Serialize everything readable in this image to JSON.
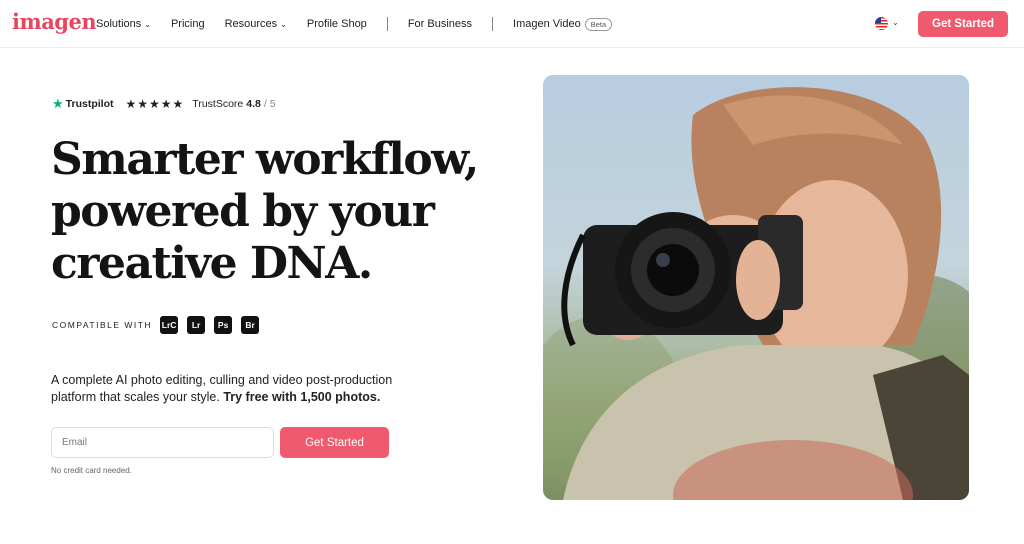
{
  "brand": {
    "logo_text": "imagen",
    "accent": "#f05a6e"
  },
  "nav": {
    "items": [
      {
        "label": "Solutions",
        "has_dropdown": true
      },
      {
        "label": "Pricing",
        "has_dropdown": false
      },
      {
        "label": "Resources",
        "has_dropdown": true
      },
      {
        "label": "Profile Shop",
        "has_dropdown": false
      }
    ],
    "business": "For Business",
    "video": "Imagen Video",
    "video_badge": "Beta",
    "language_icon": "us-flag-icon",
    "cta": "Get Started"
  },
  "hero": {
    "trustpilot": {
      "brand": "Trustpilot",
      "stars": "★★★★★",
      "label": "TrustScore",
      "score": "4.8",
      "out_of": "/ 5"
    },
    "headline": [
      "Smarter workflow,",
      "powered by your",
      "creative DNA."
    ],
    "compatible_label": "COMPATIBLE WITH",
    "apps": [
      "LrC",
      "Lr",
      "Ps",
      "Br"
    ],
    "description": "A complete AI photo editing, culling and video post-production platform that scales your style.",
    "description_bold": "Try free with 1,500 photos.",
    "email_placeholder": "Email",
    "cta": "Get Started",
    "note": "No credit card needed."
  }
}
